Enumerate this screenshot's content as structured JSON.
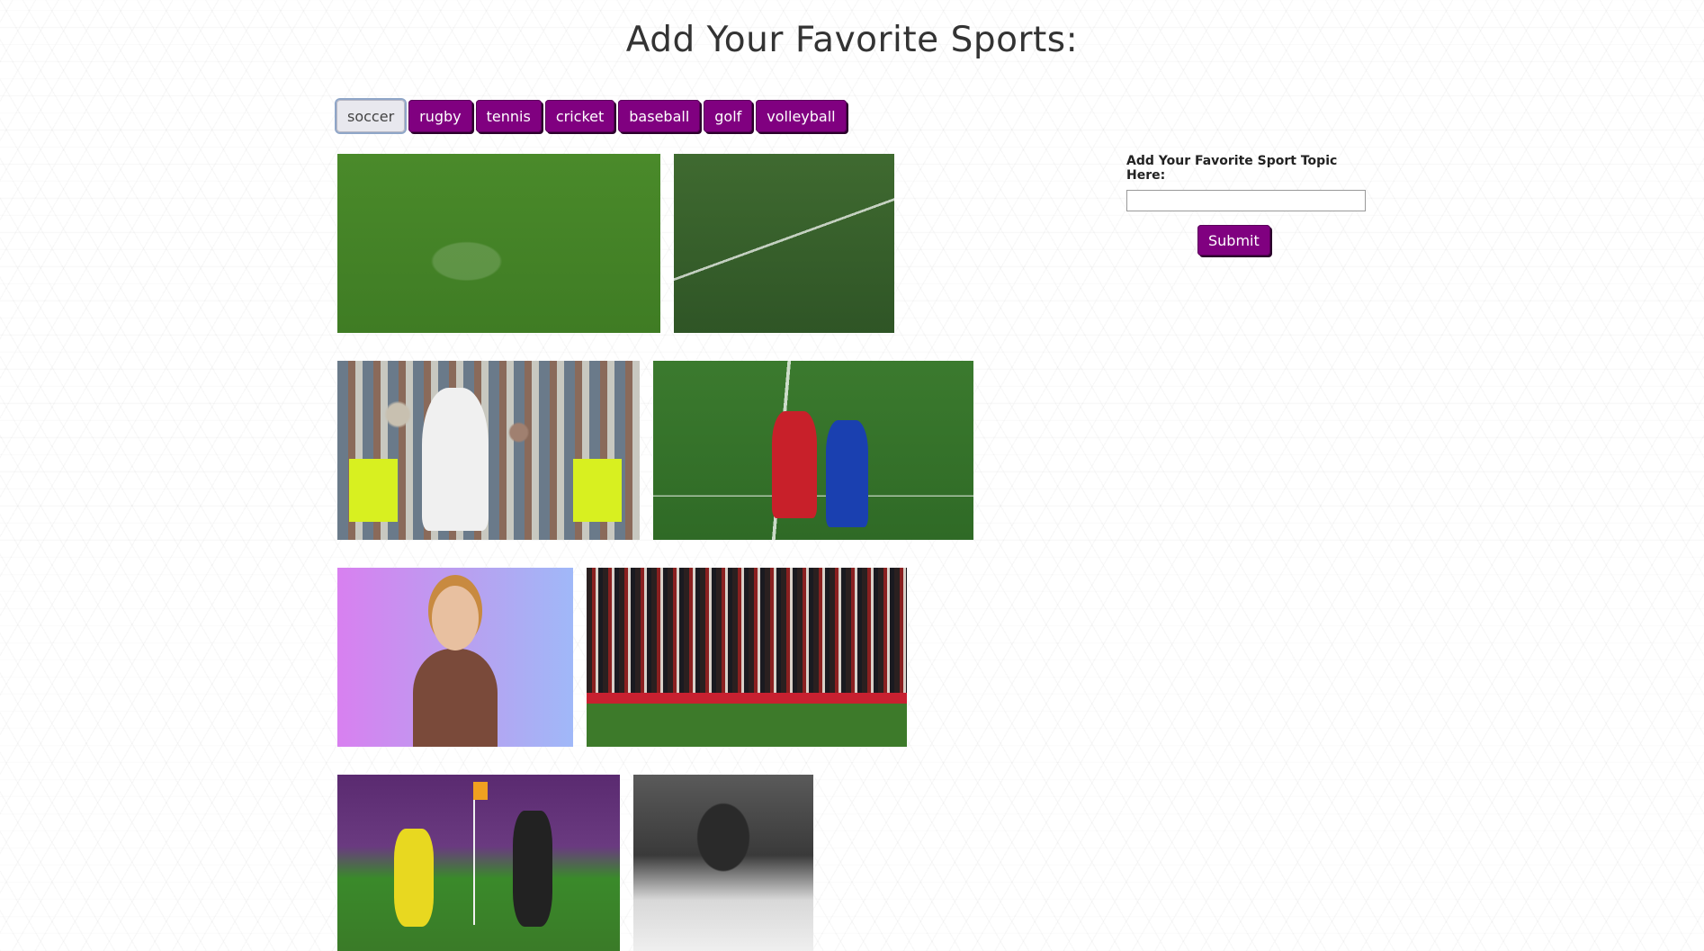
{
  "page": {
    "title": "Add Your Favorite Sports:"
  },
  "topics": [
    {
      "label": "soccer",
      "active": true
    },
    {
      "label": "rugby",
      "active": false
    },
    {
      "label": "tennis",
      "active": false
    },
    {
      "label": "cricket",
      "active": false
    },
    {
      "label": "baseball",
      "active": false
    },
    {
      "label": "golf",
      "active": false
    },
    {
      "label": "volleyball",
      "active": false
    }
  ],
  "gifs": [
    {
      "description": "soccer-gif-1"
    },
    {
      "description": "soccer-gif-2"
    },
    {
      "description": "soccer-gif-3"
    },
    {
      "description": "soccer-gif-4"
    },
    {
      "description": "soccer-gif-5"
    },
    {
      "description": "soccer-gif-6"
    },
    {
      "description": "soccer-gif-7"
    },
    {
      "description": "soccer-gif-8"
    }
  ],
  "form": {
    "label": "Add Your Favorite Sport Topic Here:",
    "input_value": "",
    "submit_label": "Submit"
  },
  "colors": {
    "button": "#800080",
    "button_text": "#ffffff",
    "active_button": "#e8e8ee"
  }
}
